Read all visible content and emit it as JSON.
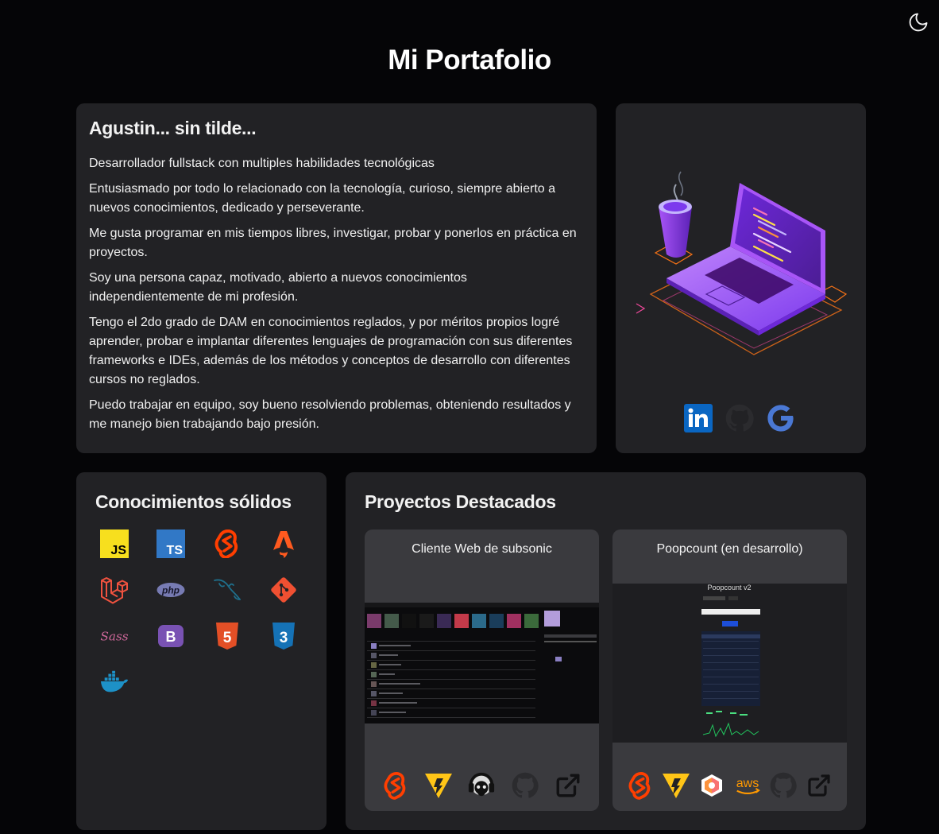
{
  "header": {
    "title": "Mi Portafolio",
    "theme_toggle_icon": "moon-icon"
  },
  "about": {
    "heading": "Agustin... sin tilde...",
    "paragraphs": [
      "Desarrollador fullstack con multiples habilidades tecnológicas",
      "Entusiasmado por todo lo relacionado con la tecnología, curioso, siempre abierto a nuevos conocimientos, dedicado y perseverante.",
      "Me gusta programar en mis tiempos libres, investigar, probar y ponerlos en práctica en proyectos.",
      "Soy una persona capaz, motivado, abierto a nuevos conocimientos independientemente de mi profesión.",
      "Tengo el 2do grado de DAM en conocimientos reglados, y por méritos propios logré aprender, probar e implantar diferentes lenguajes de programación con sus diferentes frameworks e IDEs, además de los métodos y conceptos de desarrollo con diferentes cursos no reglados.",
      "Puedo trabajar en equipo, soy bueno resolviendo problemas, obteniendo resultados y me manejo bien trabajando bajo presión."
    ]
  },
  "profile": {
    "illustration": "laptop-coffee-illustration",
    "socials": [
      {
        "icon": "linkedin-icon",
        "color": "#0a66c2"
      },
      {
        "icon": "github-icon",
        "color": "#2b2b2e"
      },
      {
        "icon": "google-icon",
        "color": "#4a78d4"
      }
    ]
  },
  "skills": {
    "heading": "Conocimientos sólidos",
    "items": [
      {
        "icon": "javascript-icon",
        "text": "JS"
      },
      {
        "icon": "typescript-icon",
        "text": "TS"
      },
      {
        "icon": "svelte-icon"
      },
      {
        "icon": "astro-icon"
      },
      {
        "icon": "laravel-icon"
      },
      {
        "icon": "php-icon",
        "text": "php"
      },
      {
        "icon": "mysql-icon"
      },
      {
        "icon": "git-icon"
      },
      {
        "icon": "sass-icon",
        "text": "Sass"
      },
      {
        "icon": "bootstrap-icon",
        "text": "B"
      },
      {
        "icon": "html5-icon",
        "text": "5"
      },
      {
        "icon": "css3-icon",
        "text": "3"
      },
      {
        "icon": "docker-icon"
      }
    ]
  },
  "projects": {
    "heading": "Proyectos Destacados",
    "items": [
      {
        "title": "Cliente Web de subsonic",
        "techs": [
          "svelte-icon",
          "vite-icon",
          "subsonic-icon",
          "github-icon",
          "external-link-icon"
        ]
      },
      {
        "title": "Poopcount (en desarrollo)",
        "screenshot_title": "Poopcount v2",
        "techs": [
          "svelte-icon",
          "vite-icon",
          "appwrite-icon",
          "aws-icon",
          "github-icon",
          "external-link-icon"
        ],
        "aws_label": "aws"
      }
    ]
  },
  "colors": {
    "background": "#050507",
    "card": "#222225",
    "project_card": "#3a3a3e",
    "accent_purple": "#7c3aed"
  }
}
